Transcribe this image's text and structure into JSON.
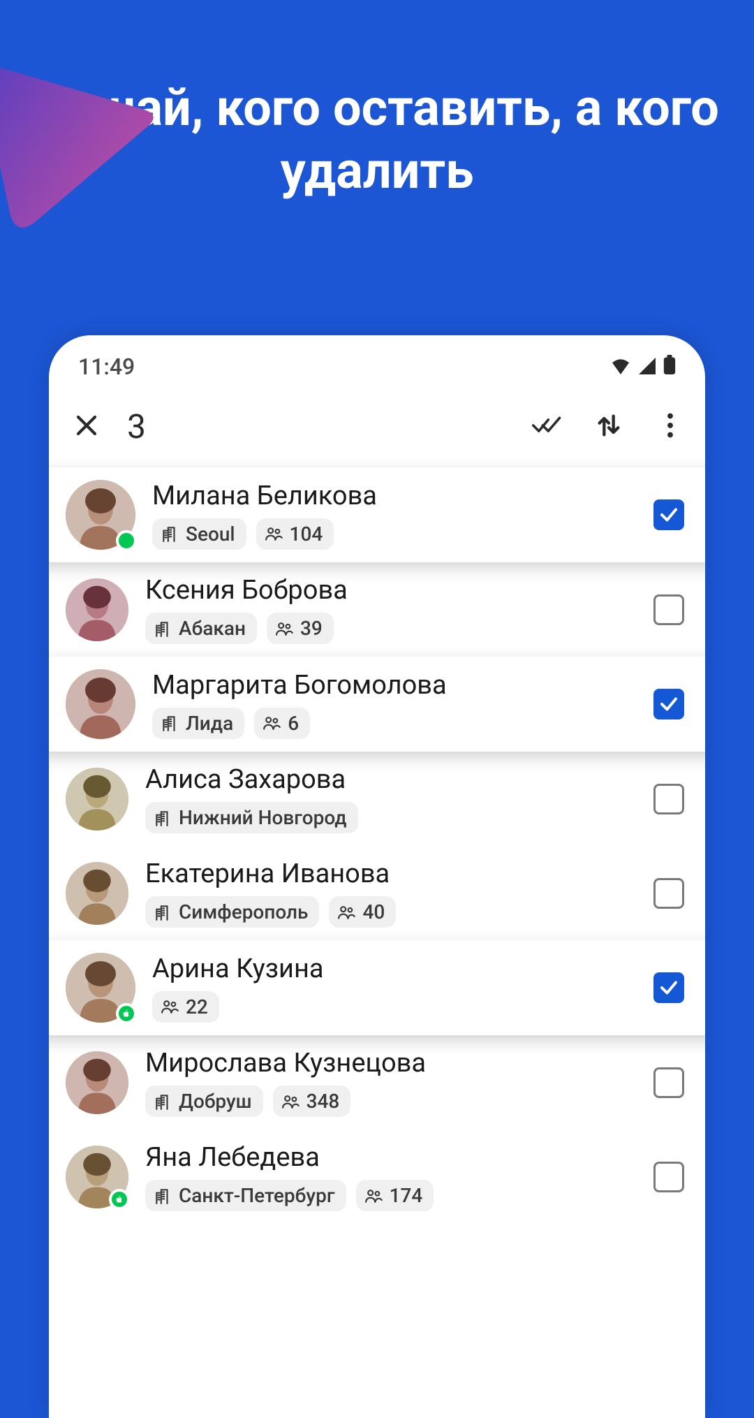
{
  "headline": "Решай, кого оставить,\nа кого удалить",
  "status": {
    "time": "11:49"
  },
  "toolbar": {
    "count": "3"
  },
  "users": [
    {
      "name": "Милана Беликова",
      "city": "Seoul",
      "mutual": "104",
      "selected": true,
      "presence": "online",
      "avatar_hue": "20"
    },
    {
      "name": "Ксения Боброва",
      "city": "Абакан",
      "mutual": "39",
      "selected": false,
      "presence": "",
      "avatar_hue": "350"
    },
    {
      "name": "Маргарита Богомолова",
      "city": "Лида",
      "mutual": "6",
      "selected": true,
      "presence": "",
      "avatar_hue": "10"
    },
    {
      "name": "Алиса Захарова",
      "city": "Нижний Новгород",
      "mutual": "",
      "selected": false,
      "presence": "",
      "avatar_hue": "45"
    },
    {
      "name": "Екатерина Иванова",
      "city": "Симферополь",
      "mutual": "40",
      "selected": false,
      "presence": "",
      "avatar_hue": "30"
    },
    {
      "name": "Арина Кузина",
      "city": "",
      "mutual": "22",
      "selected": true,
      "presence": "apple",
      "avatar_hue": "25"
    },
    {
      "name": "Мирослава Кузнецова",
      "city": "Добруш",
      "mutual": "348",
      "selected": false,
      "presence": "",
      "avatar_hue": "15"
    },
    {
      "name": "Яна Лебедева",
      "city": "Санкт-Петербург",
      "mutual": "174",
      "selected": false,
      "presence": "apple",
      "avatar_hue": "35"
    }
  ]
}
